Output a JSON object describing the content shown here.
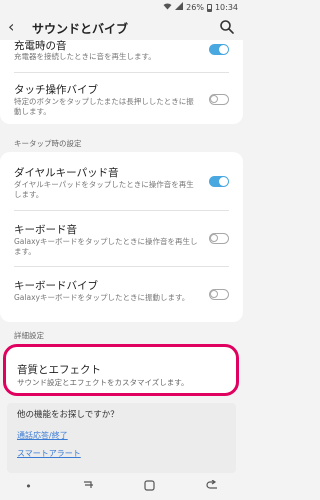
{
  "status": {
    "battery": "26%",
    "time": "10:34"
  },
  "header": {
    "title": "サウンドとバイブ"
  },
  "items": [
    {
      "label": "充電時の音",
      "desc": "充電器を接続したときに音を再生します。",
      "toggle": "on"
    },
    {
      "label": "タッチ操作バイブ",
      "desc": "特定のボタンをタップしたまたは長押ししたときに振動します。",
      "toggle": "off"
    },
    {
      "label": "ダイヤルキーパッド音",
      "desc": "ダイヤルキーパッドをタップしたときに操作音を再生します。",
      "toggle": "on"
    },
    {
      "label": "キーボード音",
      "desc": "Galaxyキーボードをタップしたときに操作音を再生します。",
      "toggle": "off"
    },
    {
      "label": "キーボードバイブ",
      "desc": "Galaxyキーボードをタップしたときに振動します。",
      "toggle": "off"
    }
  ],
  "sections": {
    "keytap": "キータップ時の設定",
    "advanced": "詳細設定"
  },
  "effects": {
    "label": "音質とエフェクト",
    "desc": "サウンド設定とエフェクトをカスタマイズします。"
  },
  "help": {
    "heading": "他の機能をお探しですか？",
    "links": [
      "通話応答/終了",
      "スマートアラート"
    ]
  },
  "colors": {
    "accent": "#4aa8e0",
    "highlight": "#e0005f",
    "link": "#3a7bd5"
  }
}
